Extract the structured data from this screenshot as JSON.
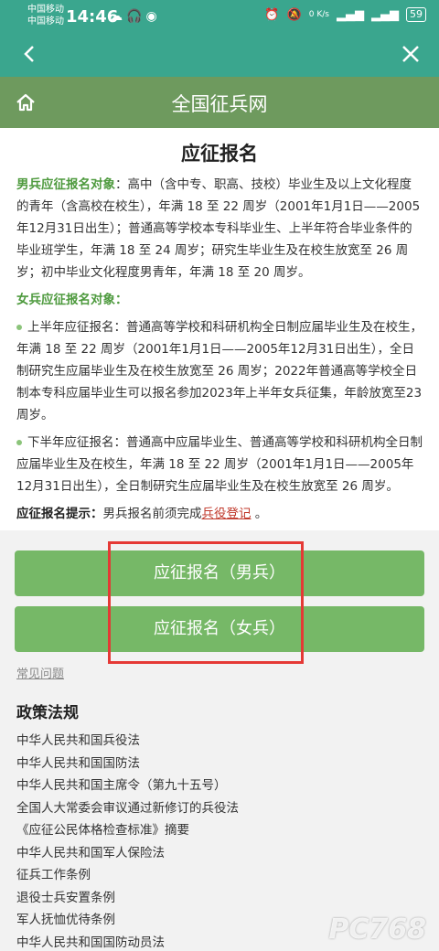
{
  "status_bar": {
    "carrier_1": "中国移动",
    "carrier_2": "中国移动",
    "time": "14:46",
    "network_speed": "0 K/s",
    "battery": "59"
  },
  "navbar": {
    "back_icon": "chevron-left-icon",
    "close_icon": "close-icon"
  },
  "site": {
    "title": "全国征兵网",
    "home_icon": "home-icon"
  },
  "page": {
    "title": "应征报名",
    "male_label": "男兵应征报名对象",
    "male_text": "：高中（含中专、职高、技校）毕业生及以上文化程度的青年（含高校在校生），年满 18 至 22 周岁（2001年1月1日——2005年12月31日出生）；普通高等学校本专科毕业生、上半年符合毕业条件的毕业班学生，年满 18 至 24 周岁；研究生毕业生及在校生放宽至 26 周岁；初中毕业文化程度男青年，年满 18 至 20 周岁。",
    "female_label": "女兵应征报名对象",
    "female_colon": "：",
    "female_items": [
      "上半年应征报名：普通高等学校和科研机构全日制应届毕业生及在校生，年满 18 至 22 周岁（2001年1月1日——2005年12月31日出生），全日制研究生应届毕业生及在校生放宽至 26 周岁；2022年普通高等学校全日制本专科应届毕业生可以报名参加2023年上半年女兵征集，年龄放宽至23周岁。",
      "下半年应征报名：普通高中应届毕业生、普通高等学校和科研机构全日制应届毕业生及在校生，年满 18 至 22 周岁（2001年1月1日——2005年12月31日出生），全日制研究生应届毕业生及在校生放宽至 26 周岁。"
    ],
    "tip_label": "应征报名提示：",
    "tip_text": "男兵报名前须完成",
    "tip_link": "兵役登记",
    "tip_end": " 。"
  },
  "buttons": {
    "male": "应征报名（男兵）",
    "female": "应征报名（女兵）"
  },
  "faq_link": "常见问题",
  "policy": {
    "title": "政策法规",
    "items": [
      "中华人民共和国兵役法",
      "中华人民共和国国防法",
      "中华人民共和国主席令（第九十五号）",
      "全国人大常委会审议通过新修订的兵役法",
      "《应征公民体格检查标准》摘要",
      "中华人民共和国军人保险法",
      "征兵工作条例",
      "退役士兵安置条例",
      "军人抚恤优待条例",
      "中华人民共和国国防动员法"
    ]
  },
  "watermark": "PC768",
  "colors": {
    "status_bar": "#3aa68e",
    "site_bar": "#6e9a5e",
    "button": "#76b867",
    "label_green": "#4e9a3e",
    "highlight_red": "#e53935"
  }
}
